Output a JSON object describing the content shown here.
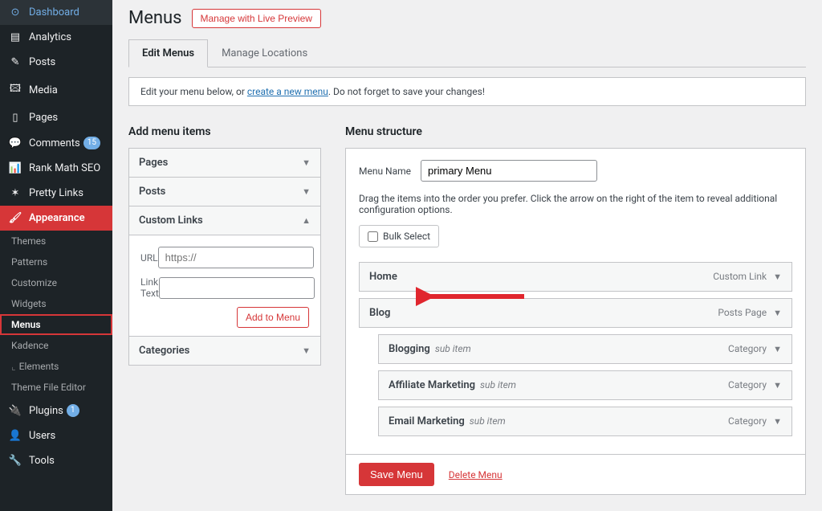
{
  "sidebar": {
    "items": [
      {
        "icon": "⊙",
        "label": "Dashboard"
      },
      {
        "icon": "▤",
        "label": "Analytics"
      },
      {
        "icon": "✎",
        "label": "Posts"
      },
      {
        "icon": "🖾",
        "label": "Media"
      },
      {
        "icon": "▯",
        "label": "Pages"
      },
      {
        "icon": "💬",
        "label": "Comments",
        "count": "15",
        "count_color": "blue"
      },
      {
        "icon": "📊",
        "label": "Rank Math SEO"
      },
      {
        "icon": "✶",
        "label": "Pretty Links"
      },
      {
        "icon": "🖌",
        "label": "Appearance",
        "active": true
      },
      {
        "icon": "🔌",
        "label": "Plugins",
        "count": "1",
        "count_color": "blue"
      },
      {
        "icon": "👤",
        "label": "Users"
      },
      {
        "icon": "🔧",
        "label": "Tools"
      }
    ],
    "submenu": [
      "Themes",
      "Patterns",
      "Customize",
      "Widgets",
      "Menus",
      "Kadence",
      "Elements",
      "Theme File Editor"
    ],
    "submenu_current": "Menus",
    "submenu_after": "Appearance"
  },
  "header": {
    "title": "Menus",
    "live_preview": "Manage with Live Preview"
  },
  "tabs": {
    "edit": "Edit Menus",
    "locations": "Manage Locations"
  },
  "notice": {
    "prefix": "Edit your menu below, or ",
    "link": "create a new menu",
    "suffix": ". Do not forget to save your changes!"
  },
  "left": {
    "title": "Add menu items",
    "panels": {
      "pages": "Pages",
      "posts": "Posts",
      "custom": "Custom Links",
      "categories": "Categories"
    },
    "custom_form": {
      "url_label": "URL",
      "url_placeholder": "https://",
      "text_label": "Link Text",
      "add_btn": "Add to Menu"
    }
  },
  "right": {
    "title": "Menu structure",
    "name_label": "Menu Name",
    "name_value": "primary Menu",
    "hint": "Drag the items into the order you prefer. Click the arrow on the right of the item to reveal additional configuration options.",
    "bulk": "Bulk Select",
    "items": [
      {
        "label": "Home",
        "type": "Custom Link",
        "indent": false
      },
      {
        "label": "Blog",
        "type": "Posts Page",
        "indent": false
      },
      {
        "label": "Blogging",
        "type": "Category",
        "indent": true,
        "sub": "sub item"
      },
      {
        "label": "Affiliate Marketing",
        "type": "Category",
        "indent": true,
        "sub": "sub item"
      },
      {
        "label": "Email Marketing",
        "type": "Category",
        "indent": true,
        "sub": "sub item"
      }
    ],
    "save_btn": "Save Menu",
    "delete_link": "Delete Menu"
  }
}
